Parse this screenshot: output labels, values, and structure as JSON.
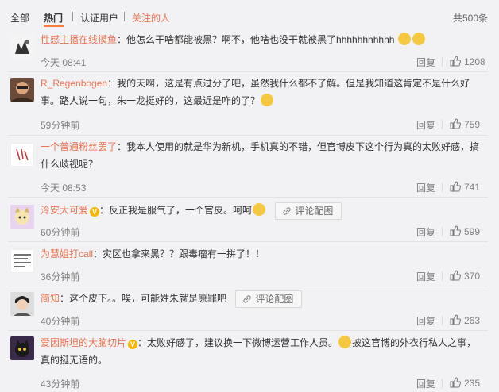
{
  "tabs": {
    "all": "全部",
    "hot": "热门",
    "verified": "认证用户",
    "following": "关注的人",
    "total": "共500条"
  },
  "comments": [
    {
      "user": "性感主播在线摸鱼",
      "text": "：他怎么干啥都能被黑？啊不，他啥也没干就被黑了hhhhhhhhhhh",
      "time": "今天 08:41",
      "reply": "回复",
      "likes": "1208",
      "emoji": [
        "doge-emoji",
        "doge-emoji"
      ]
    },
    {
      "user": "R_Regenbogen",
      "text_line1": "：我的天啊，这是有点过分了吧，虽然我什么都不了解。但是我知道这肯定不是什么好",
      "text_line2": "事。路人说一句，朱一龙挺好的，这最近是咋的了？",
      "time": "59分钟前",
      "reply": "回复",
      "likes": "759",
      "emoji": [
        "thinking-emoji"
      ]
    },
    {
      "user": "一个普通粉丝罢了",
      "text_line1": "：我本人使用的就是华为新机，手机真的不错，但官博皮下这个行为真的太败好感，搞",
      "text_line2": "什么歧视呢？",
      "time": "今天 08:53",
      "reply": "回复",
      "likes": "741"
    },
    {
      "user": "泠安大可爱",
      "text": "：反正我是服气了，一个官皮。呵呵",
      "pic_button": "评论配图",
      "time": "60分钟前",
      "reply": "回复",
      "likes": "599",
      "emoji": [
        "doge-emoji"
      ]
    },
    {
      "user": "为慧姐打call",
      "text": "：灾区也拿来黑？？跟毒瘤有一拼了！！",
      "time": "36分钟前",
      "reply": "回复",
      "likes": "370"
    },
    {
      "user": "简知",
      "text": "：这个皮下。。唉，可能姓朱就是原罪吧",
      "pic_button": "评论配图",
      "time": "40分钟前",
      "reply": "回复",
      "likes": "263"
    },
    {
      "user": "爱因斯坦的大脑切片",
      "text_line1a": "：太败好感了，建议换一下微博运营工作人员。",
      "text_line1b": "披这官博的外衣行私人之事，",
      "text_line2": "真的挺无语的。",
      "time": "43分钟前",
      "reply": "回复",
      "likes": "235",
      "emoji": [
        "thinking-emoji"
      ]
    }
  ],
  "colors": {
    "accent": "#eb7350",
    "underline": "#fa7d3c",
    "vip": "#f7b600",
    "muted": "#808080",
    "background": "#f2f2f5"
  }
}
